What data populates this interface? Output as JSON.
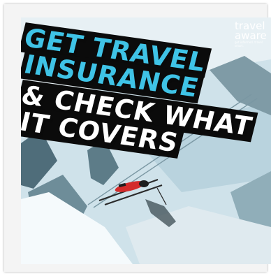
{
  "poster": {
    "headline_lines": [
      "GET TRAVEL",
      "INSURANCE",
      "& CHECK WHAT",
      "IT COVERS"
    ],
    "logo": {
      "line1": "travel",
      "line2": "aware",
      "tagline": "get informed. travel smart."
    }
  },
  "colors": {
    "sky": "#c9dde6",
    "snow": "#eef5f8",
    "slope_shadow": "#a9c7d3",
    "rock": "#5f7f8c",
    "headline_blue": "#3fc3e6",
    "headline_white": "#ffffff",
    "headline_shadow": "#0a0a0a",
    "skier_jacket": "#d32b2b"
  }
}
